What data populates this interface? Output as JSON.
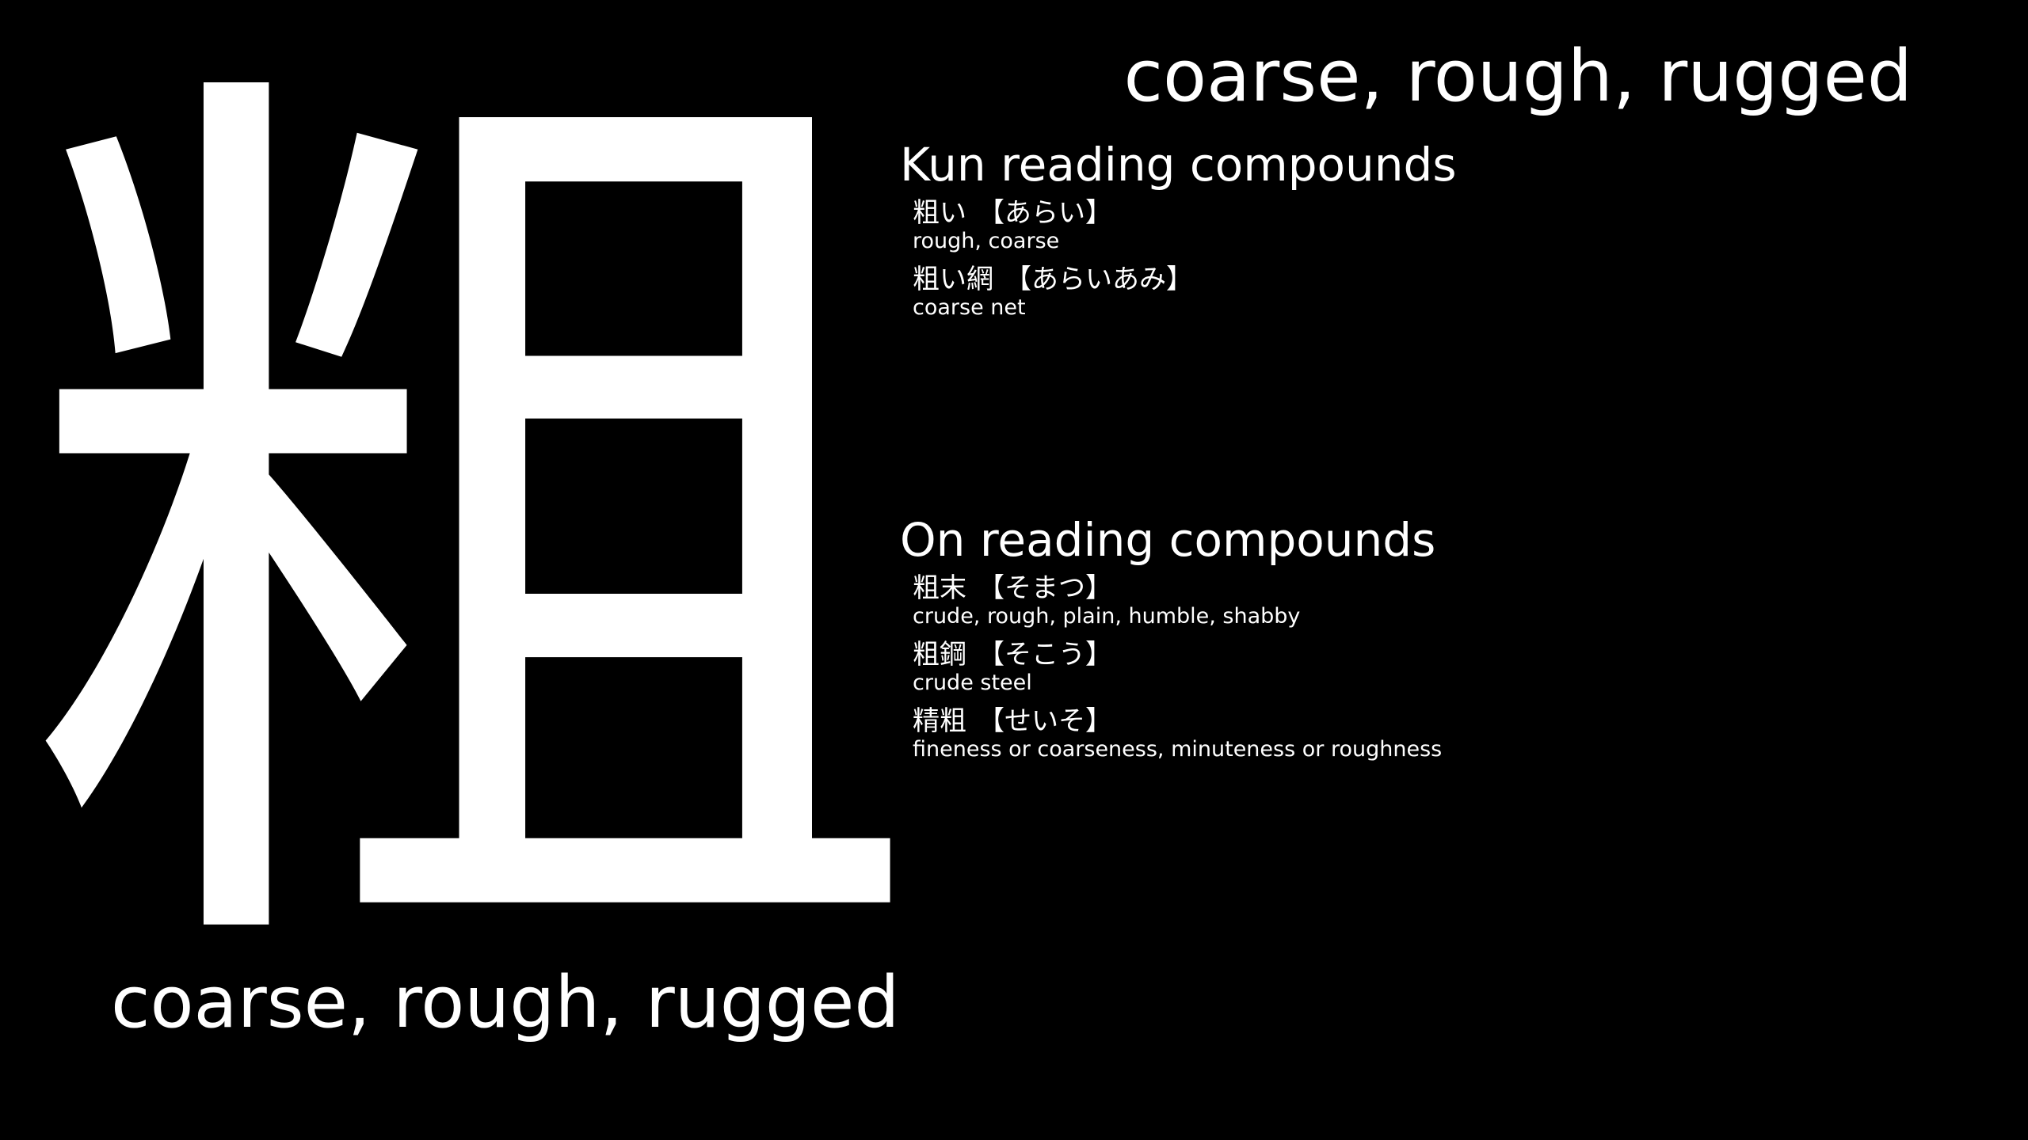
{
  "kanji": "粗",
  "meaning": "coarse, rough, rugged",
  "kun_section": {
    "heading": "Kun reading compounds",
    "items": [
      {
        "word": "粗い",
        "reading": "【あらい】",
        "gloss": "rough, coarse"
      },
      {
        "word": "粗い網",
        "reading": "【あらいあみ】",
        "gloss": "coarse net"
      }
    ]
  },
  "on_section": {
    "heading": "On reading compounds",
    "items": [
      {
        "word": "粗末",
        "reading": "【そまつ】",
        "gloss": "crude, rough, plain, humble, shabby"
      },
      {
        "word": "粗鋼",
        "reading": "【そこう】",
        "gloss": "crude steel"
      },
      {
        "word": "精粗",
        "reading": "【せいそ】",
        "gloss": "fineness or coarseness, minuteness or roughness"
      }
    ]
  }
}
